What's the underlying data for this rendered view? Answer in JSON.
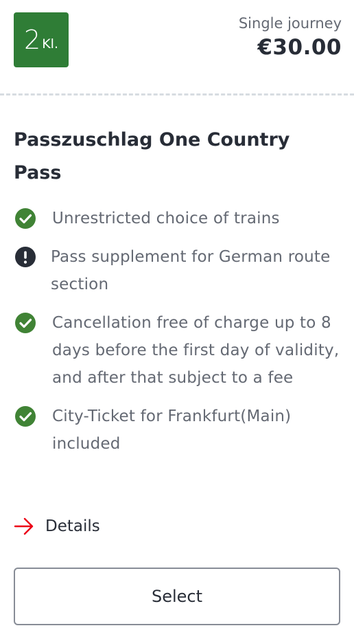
{
  "ticket": {
    "class_number": "2",
    "class_suffix": "Kl.",
    "journey_type": "Single journey",
    "price": "€30.00",
    "offer_title": "Passzuschlag One Country Pass",
    "features": [
      {
        "icon": "check-circle-icon",
        "text": "Unrestricted choice of trains"
      },
      {
        "icon": "exclamation-circle-icon",
        "text": "Pass supplement for German route section"
      },
      {
        "icon": "check-circle-icon",
        "text": "Cancellation free of charge up to 8 days before the first day of validity, and after that subject to a fee"
      },
      {
        "icon": "check-circle-icon",
        "text": "City-Ticket for Frankfurt(Main) included"
      }
    ],
    "details_label": "Details",
    "select_label": "Select"
  },
  "colors": {
    "class_badge": "#2f7d36",
    "check_icon": "#408335",
    "warning_icon": "#282d37",
    "details_arrow": "#ec0016",
    "text_primary": "#282d37",
    "text_secondary": "#646973"
  }
}
